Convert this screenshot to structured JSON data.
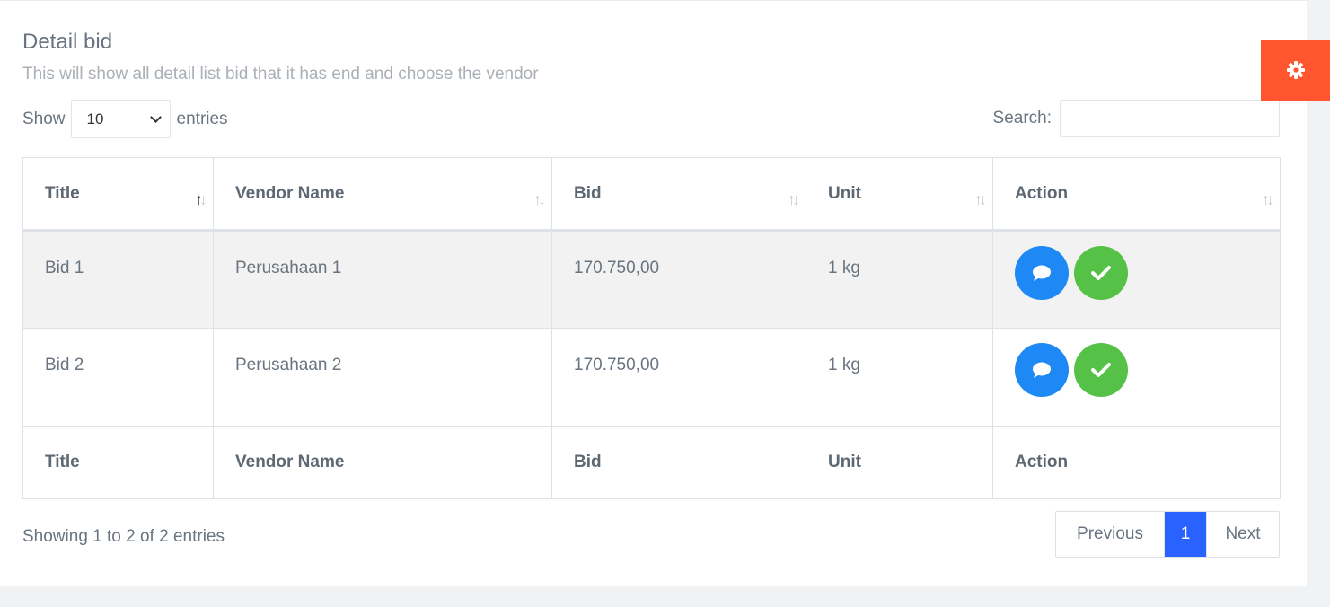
{
  "header": {
    "title": "Detail bid",
    "subtitle": "This will show all detail list bid that it has end and choose the vendor"
  },
  "length_menu": {
    "show_label": "Show",
    "selected": "10",
    "entries_label": "entries"
  },
  "search": {
    "label": "Search:",
    "value": ""
  },
  "table": {
    "columns": [
      "Title",
      "Vendor Name",
      "Bid",
      "Unit",
      "Action"
    ],
    "rows": [
      {
        "title": "Bid 1",
        "vendor": "Perusahaan 1",
        "bid": "170.750,00",
        "unit": "1 kg"
      },
      {
        "title": "Bid 2",
        "vendor": "Perusahaan 2",
        "bid": "170.750,00",
        "unit": "1 kg"
      }
    ],
    "sorted_column": "Title",
    "action_icons": [
      "chat-icon",
      "check-icon"
    ]
  },
  "info": "Showing 1 to 2 of 2 entries",
  "pagination": {
    "previous": "Previous",
    "current": "1",
    "next": "Next"
  },
  "colors": {
    "accent": "#2962ff",
    "chat_button": "#1e88f5",
    "approve_button": "#55c147",
    "settings_tab": "#ff5630"
  },
  "settings_icon": "gear-icon"
}
